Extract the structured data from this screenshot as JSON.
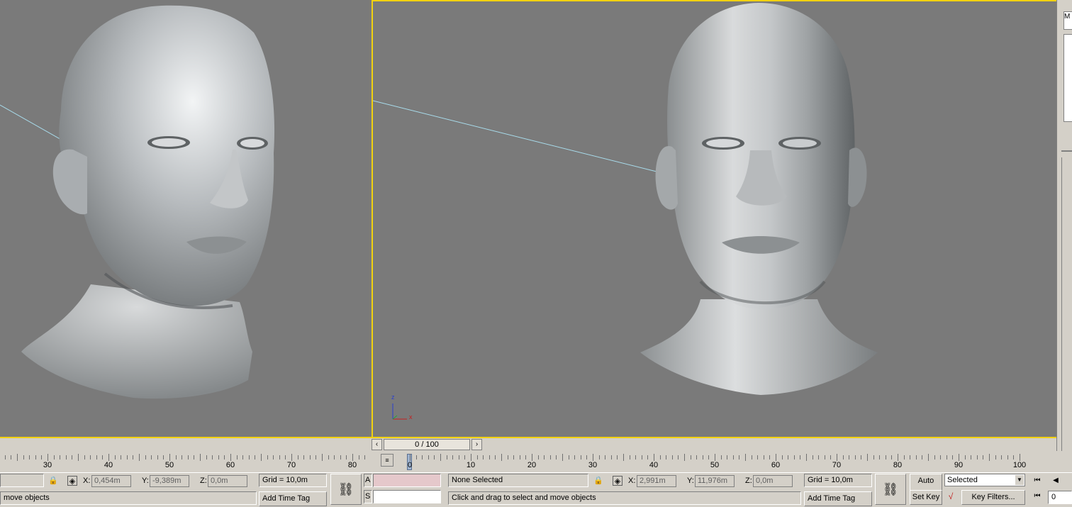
{
  "statusbar": {
    "left": {
      "prompt": "move objects",
      "x_label": "X:",
      "x_value": "0,454m",
      "y_label": "Y:",
      "y_value": "-9,389m",
      "z_label": "Z:",
      "z_value": "0,0m",
      "grid": "Grid = 10,0m",
      "add_time_tag": "Add Time Tag",
      "partial_a": "A",
      "partial_s": "S"
    },
    "right": {
      "selection": "None Selected",
      "prompt": "Click and drag to select and move objects",
      "x_label": "X:",
      "x_value": "2,991m",
      "y_label": "Y:",
      "y_value": "11,976m",
      "z_label": "Z:",
      "z_value": "0,0m",
      "grid": "Grid = 10,0m",
      "add_time_tag": "Add Time Tag",
      "auto_key": "Auto Key",
      "set_key": "Set Key",
      "selected": "Selected",
      "key_filters": "Key Filters...",
      "frame": "0"
    }
  },
  "timeline": {
    "frame_display": "0 / 100",
    "left_labels": [
      "30",
      "40",
      "50",
      "60",
      "70",
      "80"
    ],
    "right_labels": [
      "0",
      "10",
      "20",
      "30",
      "40",
      "50",
      "60",
      "70",
      "80",
      "90",
      "100"
    ]
  },
  "axis_gizmo": {
    "z": "z",
    "x": "x"
  },
  "icons": {
    "lock": "lock-icon",
    "key": "key-icon",
    "curve": "curve-icon",
    "playback": "go-to-start-icon",
    "prev_frame": "previous-frame-icon"
  },
  "colors": {
    "viewport_bg": "#7a7a7a",
    "active_border": "#f2d20f",
    "ui_bg": "#d4d0c8",
    "selection_line": "#a8dcec"
  }
}
